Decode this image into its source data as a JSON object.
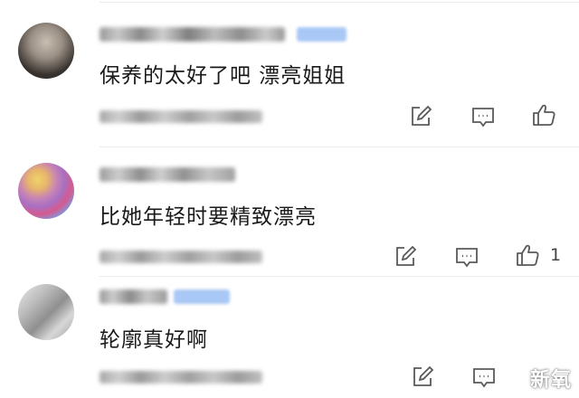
{
  "comments": [
    {
      "text": "保养的太好了吧 漂亮姐姐",
      "like_count": ""
    },
    {
      "text": "比她年轻时要精致漂亮",
      "like_count": "1"
    },
    {
      "text": "轮廓真好啊",
      "like_count": ""
    }
  ],
  "watermark": "新氧",
  "icons": {
    "reply": "edit-square-icon",
    "comment": "chat-bubble-icon",
    "like": "thumbs-up-icon"
  },
  "colors": {
    "text": "#1a1a1a",
    "icon": "#5a5a5a",
    "badge": "#a9c8f5"
  }
}
